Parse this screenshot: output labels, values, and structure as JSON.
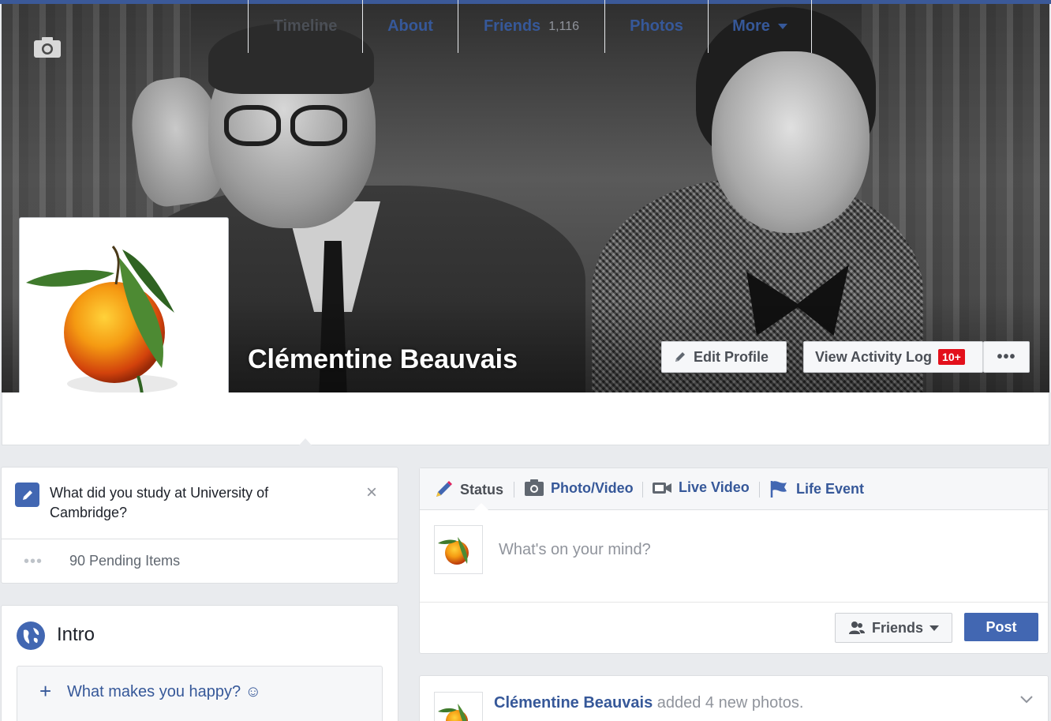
{
  "profile": {
    "name": "Clémentine Beauvais",
    "edit_profile_label": "Edit Profile",
    "view_activity_log_label": "View Activity Log",
    "activity_badge": "10+",
    "more_options_label": "•••"
  },
  "nav": {
    "timeline": "Timeline",
    "about": "About",
    "friends": "Friends",
    "friends_count": "1,116",
    "photos": "Photos",
    "more": "More"
  },
  "question": {
    "text": "What did you study at University of Cambridge?",
    "close": "×",
    "pending_dots": "•••",
    "pending_text": "90 Pending Items"
  },
  "intro": {
    "title": "Intro",
    "happy_plus": "+",
    "happy_text": "What makes you happy? ☺"
  },
  "composer": {
    "tabs": [
      "Status",
      "Photo/Video",
      "Live Video",
      "Life Event"
    ],
    "placeholder": "What's on your mind?",
    "audience_label": "Friends",
    "post_label": "Post"
  },
  "story": {
    "author": "Clémentine Beauvais",
    "action": " added 4 new photos."
  },
  "colors": {
    "brand": "#3b5998",
    "link": "#365899",
    "post_button": "#4267b2",
    "badge": "#e3101b",
    "background": "#e9ebee"
  }
}
